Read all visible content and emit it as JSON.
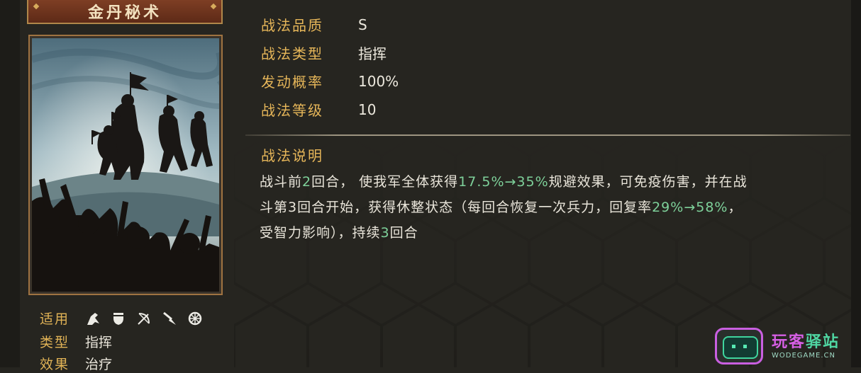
{
  "skill": {
    "name": "金丹秘术"
  },
  "stats": [
    {
      "label": "战法品质",
      "value": "S"
    },
    {
      "label": "战法类型",
      "value": "指挥"
    },
    {
      "label": "发动概率",
      "value": "100%"
    },
    {
      "label": "战法等级",
      "value": "10"
    }
  ],
  "description": {
    "title": "战法说明",
    "lines": [
      [
        "战斗前",
        {
          "hl": "2"
        },
        "回合， 使我军全体获得",
        {
          "hl": "17.5%→35%"
        },
        "规避效果，可免疫伤害，并在战"
      ],
      [
        "斗第3回合开始，获得休整状态（每回合恢复一次兵力，回复率",
        {
          "hl": "29%→58%"
        },
        "，"
      ],
      [
        "受智力影响），持续",
        {
          "hl": "3"
        },
        "回合"
      ]
    ],
    "highlight_color": "#7ed19a"
  },
  "tags": {
    "applicable_label": "适用",
    "unit_icons": [
      "cavalry-icon",
      "shield-icon",
      "archer-icon",
      "spear-icon",
      "siege-icon"
    ],
    "type_label": "类型",
    "type_value": "指挥",
    "effect_label": "效果",
    "effect_value": "治疗"
  },
  "watermark": {
    "name_part1": "玩客",
    "name_part2": "驿站",
    "url": "WODEGAME.CN"
  },
  "colors": {
    "label_gold": "#e6b659",
    "background": "#262520",
    "banner_red": "#7e3e24",
    "frame_bronze": "#9f7341"
  }
}
